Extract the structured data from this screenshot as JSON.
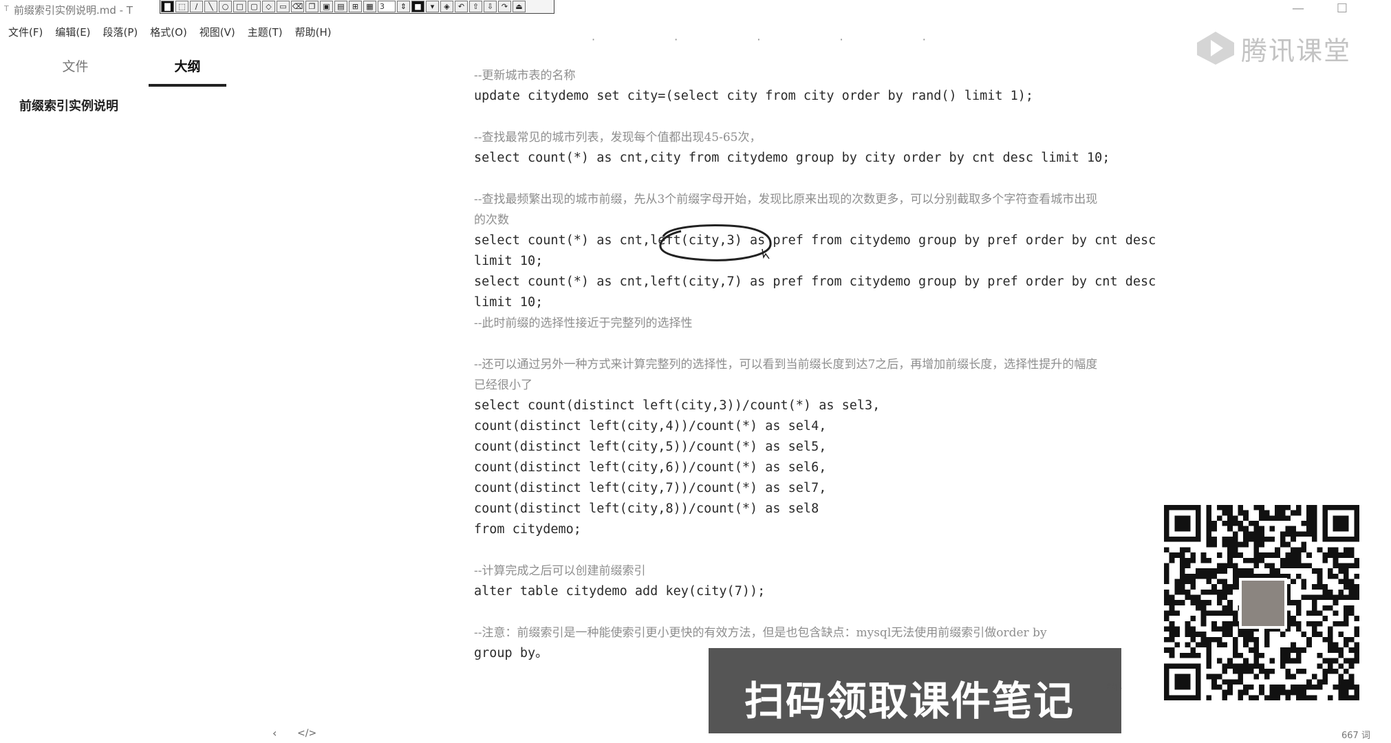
{
  "window": {
    "title": "前缀索引实例说明.md - T",
    "title_mark": "T",
    "minimize": "—",
    "maximize": "☐"
  },
  "draw_toolbar": {
    "line_width": "3"
  },
  "menu": [
    "文件(F)",
    "编辑(E)",
    "段落(P)",
    "格式(O)",
    "视图(V)",
    "主题(T)",
    "帮助(H)"
  ],
  "sidebar": {
    "tabs": [
      "文件",
      "大纲"
    ],
    "active_tab": "大纲",
    "outline": [
      "前缀索引实例说明"
    ],
    "prev_icon": "‹",
    "source_icon": "</>"
  },
  "editor": {
    "lines": [
      {
        "kind": "cm",
        "text": "--更新城市表的名称"
      },
      {
        "kind": "code",
        "text": "update citydemo set city=(select city from city order by rand() limit 1);"
      },
      {
        "kind": "gap",
        "text": ""
      },
      {
        "kind": "cm",
        "text": "--查找最常见的城市列表，发现每个值都出现45-65次，"
      },
      {
        "kind": "code",
        "text": "select count(*) as cnt,city from citydemo group by city order by cnt desc limit 10;"
      },
      {
        "kind": "gap",
        "text": ""
      },
      {
        "kind": "cm",
        "text": "--查找最频繁出现的城市前缀，先从3个前缀字母开始，发现比原来出现的次数更多，可以分别截取多个字符查看城市出现"
      },
      {
        "kind": "cm",
        "text": "的次数"
      },
      {
        "kind": "code",
        "text": "select count(*) as cnt,left(city,3) as pref from citydemo group by pref order by cnt desc"
      },
      {
        "kind": "code",
        "text": "limit 10;"
      },
      {
        "kind": "code",
        "text": "select count(*) as cnt,left(city,7) as pref from citydemo group by pref order by cnt desc"
      },
      {
        "kind": "code",
        "text": "limit 10;"
      },
      {
        "kind": "cm",
        "text": "--此时前缀的选择性接近于完整列的选择性"
      },
      {
        "kind": "gap",
        "text": ""
      },
      {
        "kind": "cm",
        "text": "--还可以通过另外一种方式来计算完整列的选择性，可以看到当前缀长度到达7之后，再增加前缀长度，选择性提升的幅度"
      },
      {
        "kind": "cm",
        "text": "已经很小了"
      },
      {
        "kind": "code",
        "text": "select count(distinct left(city,3))/count(*) as sel3,"
      },
      {
        "kind": "code",
        "text": "count(distinct left(city,4))/count(*) as sel4,"
      },
      {
        "kind": "code",
        "text": "count(distinct left(city,5))/count(*) as sel5,"
      },
      {
        "kind": "code",
        "text": "count(distinct left(city,6))/count(*) as sel6,"
      },
      {
        "kind": "code",
        "text": "count(distinct left(city,7))/count(*) as sel7,"
      },
      {
        "kind": "code",
        "text": "count(distinct left(city,8))/count(*) as sel8"
      },
      {
        "kind": "code",
        "text": "from citydemo;"
      },
      {
        "kind": "gap",
        "text": ""
      },
      {
        "kind": "cm",
        "text": "--计算完成之后可以创建前缀索引"
      },
      {
        "kind": "code",
        "text": "alter table citydemo add key(city(7));"
      },
      {
        "kind": "gap",
        "text": ""
      },
      {
        "kind": "cm",
        "text": "--注意：前缀索引是一种能使索引更小更快的有效方法，但是也包含缺点：mysql无法使用前缀索引做order by"
      },
      {
        "kind": "code",
        "text": "group by。"
      }
    ]
  },
  "watermark": {
    "text": "腾讯课堂"
  },
  "promo": {
    "text": "扫码领取课件笔记"
  },
  "code_block_lang": "sql",
  "status": {
    "word_count": "667 词"
  }
}
